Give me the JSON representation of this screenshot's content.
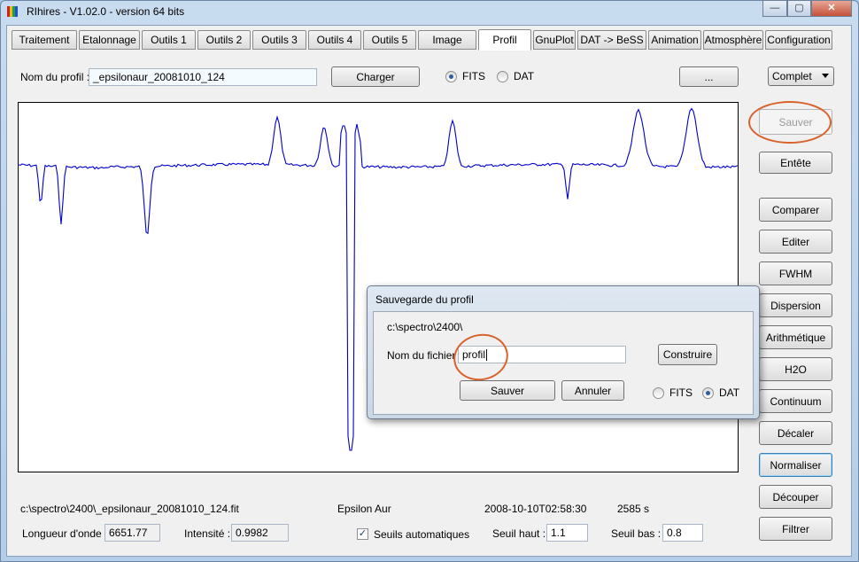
{
  "window": {
    "title": "RIhires - V1.02.0 - version 64 bits",
    "caption_buttons": {
      "minimize": "—",
      "maximize": "▢",
      "close": "✕"
    }
  },
  "tabs": [
    {
      "label": "Traitement"
    },
    {
      "label": "Etalonnage"
    },
    {
      "label": "Outils 1"
    },
    {
      "label": "Outils 2"
    },
    {
      "label": "Outils 3"
    },
    {
      "label": "Outils 4"
    },
    {
      "label": "Outils 5"
    },
    {
      "label": "Image"
    },
    {
      "label": "Profil",
      "active": true
    },
    {
      "label": "GnuPlot"
    },
    {
      "label": "DAT -> BeSS"
    },
    {
      "label": "Animation"
    },
    {
      "label": "Atmosphère"
    },
    {
      "label": "Configuration"
    }
  ],
  "profile_bar": {
    "name_label": "Nom du profil :",
    "name_value": "_epsilonaur_20081010_124",
    "load_button": "Charger",
    "format_options": [
      {
        "label": "FITS",
        "selected": true
      },
      {
        "label": "DAT",
        "selected": false
      }
    ],
    "browse_button": "...",
    "mode_select": "Complet"
  },
  "side_buttons": {
    "save": "Sauver",
    "header": "Entête",
    "actions": [
      "Comparer",
      "Editer",
      "FWHM",
      "Dispersion",
      "Arithmétique",
      "H2O",
      "Continuum",
      "Décaler",
      "Normaliser",
      "Découper",
      "Filtrer"
    ]
  },
  "dialog": {
    "title": "Sauvegarde du profil",
    "path": "c:\\spectro\\2400\\",
    "filename_label": "Nom du fichier :",
    "filename_value": "profil",
    "build_button": "Construire",
    "save_button": "Sauver",
    "cancel_button": "Annuler",
    "format_options": [
      {
        "label": "FITS",
        "selected": false
      },
      {
        "label": "DAT",
        "selected": true
      }
    ]
  },
  "status": {
    "file_path": "c:\\spectro\\2400\\_epsilonaur_20081010_124.fit",
    "object": "Epsilon Aur",
    "date": "2008-10-10T02:58:30",
    "exposure": "2585 s",
    "wavelength_label": "Longueur d'onde :",
    "wavelength_value": "6651.77",
    "intensity_label": "Intensité :",
    "intensity_value": "0.9982",
    "auto_threshold_label": "Seuils automatiques",
    "auto_threshold_checked": true,
    "high_threshold_label": "Seuil haut :",
    "high_threshold_value": "1.1",
    "low_threshold_label": "Seuil bas :",
    "low_threshold_value": "0.8"
  },
  "colors": {
    "plot_line": "#0000c8",
    "annotation": "#d9622b"
  }
}
